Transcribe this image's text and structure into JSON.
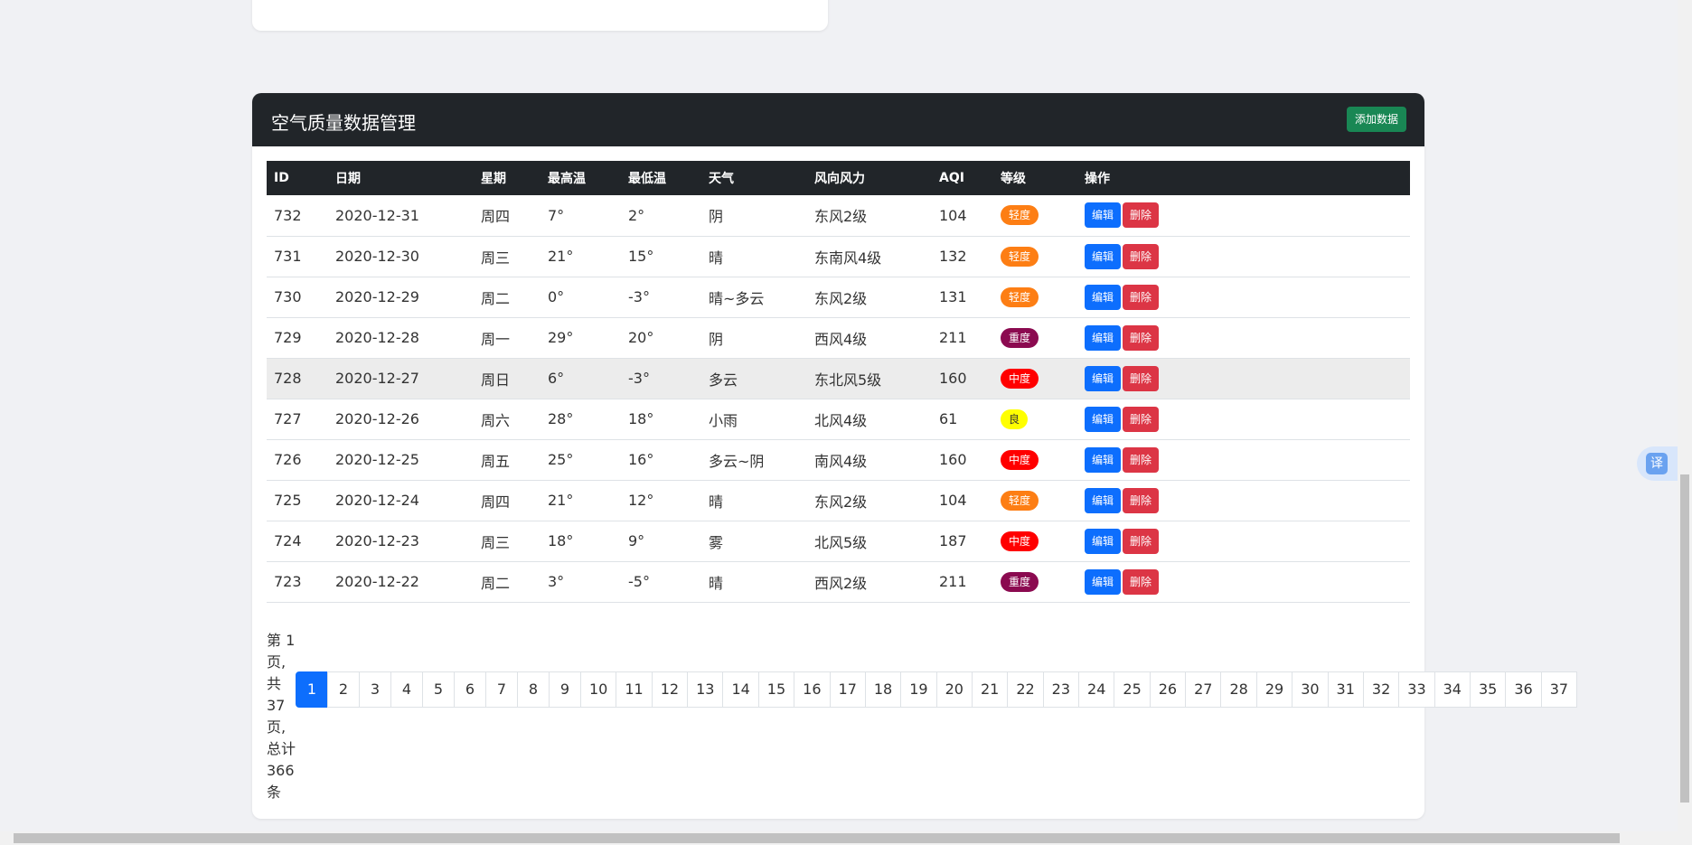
{
  "card": {
    "title": "空气质量数据管理",
    "add_button": "添加数据"
  },
  "table": {
    "headers": [
      "ID",
      "日期",
      "星期",
      "最高温",
      "最低温",
      "天气",
      "风向风力",
      "AQI",
      "等级",
      "操作"
    ],
    "rows": [
      {
        "id": "732",
        "date": "2020-12-31",
        "weekday": "周四",
        "high": "7°",
        "low": "2°",
        "weather": "阴",
        "wind": "东风2级",
        "aqi": "104",
        "level": "轻度",
        "level_color": "#fd7e14"
      },
      {
        "id": "731",
        "date": "2020-12-30",
        "weekday": "周三",
        "high": "21°",
        "low": "15°",
        "weather": "晴",
        "wind": "东南风4级",
        "aqi": "132",
        "level": "轻度",
        "level_color": "#fd7e14"
      },
      {
        "id": "730",
        "date": "2020-12-29",
        "weekday": "周二",
        "high": "0°",
        "low": "-3°",
        "weather": "晴~多云",
        "wind": "东风2级",
        "aqi": "131",
        "level": "轻度",
        "level_color": "#fd7e14"
      },
      {
        "id": "729",
        "date": "2020-12-28",
        "weekday": "周一",
        "high": "29°",
        "low": "20°",
        "weather": "阴",
        "wind": "西风4级",
        "aqi": "211",
        "level": "重度",
        "level_color": "#8b0a50"
      },
      {
        "id": "728",
        "date": "2020-12-27",
        "weekday": "周日",
        "high": "6°",
        "low": "-3°",
        "weather": "多云",
        "wind": "东北风5级",
        "aqi": "160",
        "level": "中度",
        "level_color": "#ff0000"
      },
      {
        "id": "727",
        "date": "2020-12-26",
        "weekday": "周六",
        "high": "28°",
        "low": "18°",
        "weather": "小雨",
        "wind": "北风4级",
        "aqi": "61",
        "level": "良",
        "level_color": "#ffff00"
      },
      {
        "id": "726",
        "date": "2020-12-25",
        "weekday": "周五",
        "high": "25°",
        "low": "16°",
        "weather": "多云~阴",
        "wind": "南风4级",
        "aqi": "160",
        "level": "中度",
        "level_color": "#ff0000"
      },
      {
        "id": "725",
        "date": "2020-12-24",
        "weekday": "周四",
        "high": "21°",
        "low": "12°",
        "weather": "晴",
        "wind": "东风2级",
        "aqi": "104",
        "level": "轻度",
        "level_color": "#fd7e14"
      },
      {
        "id": "724",
        "date": "2020-12-23",
        "weekday": "周三",
        "high": "18°",
        "low": "9°",
        "weather": "雾",
        "wind": "北风5级",
        "aqi": "187",
        "level": "中度",
        "level_color": "#ff0000"
      },
      {
        "id": "723",
        "date": "2020-12-22",
        "weekday": "周二",
        "high": "3°",
        "low": "-5°",
        "weather": "晴",
        "wind": "西风2级",
        "aqi": "211",
        "level": "重度",
        "level_color": "#8b0a50"
      }
    ],
    "edit_label": "编辑",
    "delete_label": "删除",
    "highlighted_row_id": "728"
  },
  "pagination": {
    "info": "第 1 页, 共 37 页, 总计 366 条",
    "current": "1",
    "pages": [
      "1",
      "2",
      "3",
      "4",
      "5",
      "6",
      "7",
      "8",
      "9",
      "10",
      "11",
      "12",
      "13",
      "14",
      "15",
      "16",
      "17",
      "18",
      "19",
      "20",
      "21",
      "22",
      "23",
      "24",
      "25",
      "26",
      "27",
      "28",
      "29",
      "30",
      "31",
      "32",
      "33",
      "34",
      "35",
      "36",
      "37"
    ]
  },
  "translate_widget": {
    "label": "译",
    "icon": "translate-icon"
  },
  "colors": {
    "header_bg": "#212529",
    "add_button": "#198754",
    "edit_button": "#0d6efd",
    "delete_button": "#dc3545",
    "active_page": "#0d6efd"
  }
}
